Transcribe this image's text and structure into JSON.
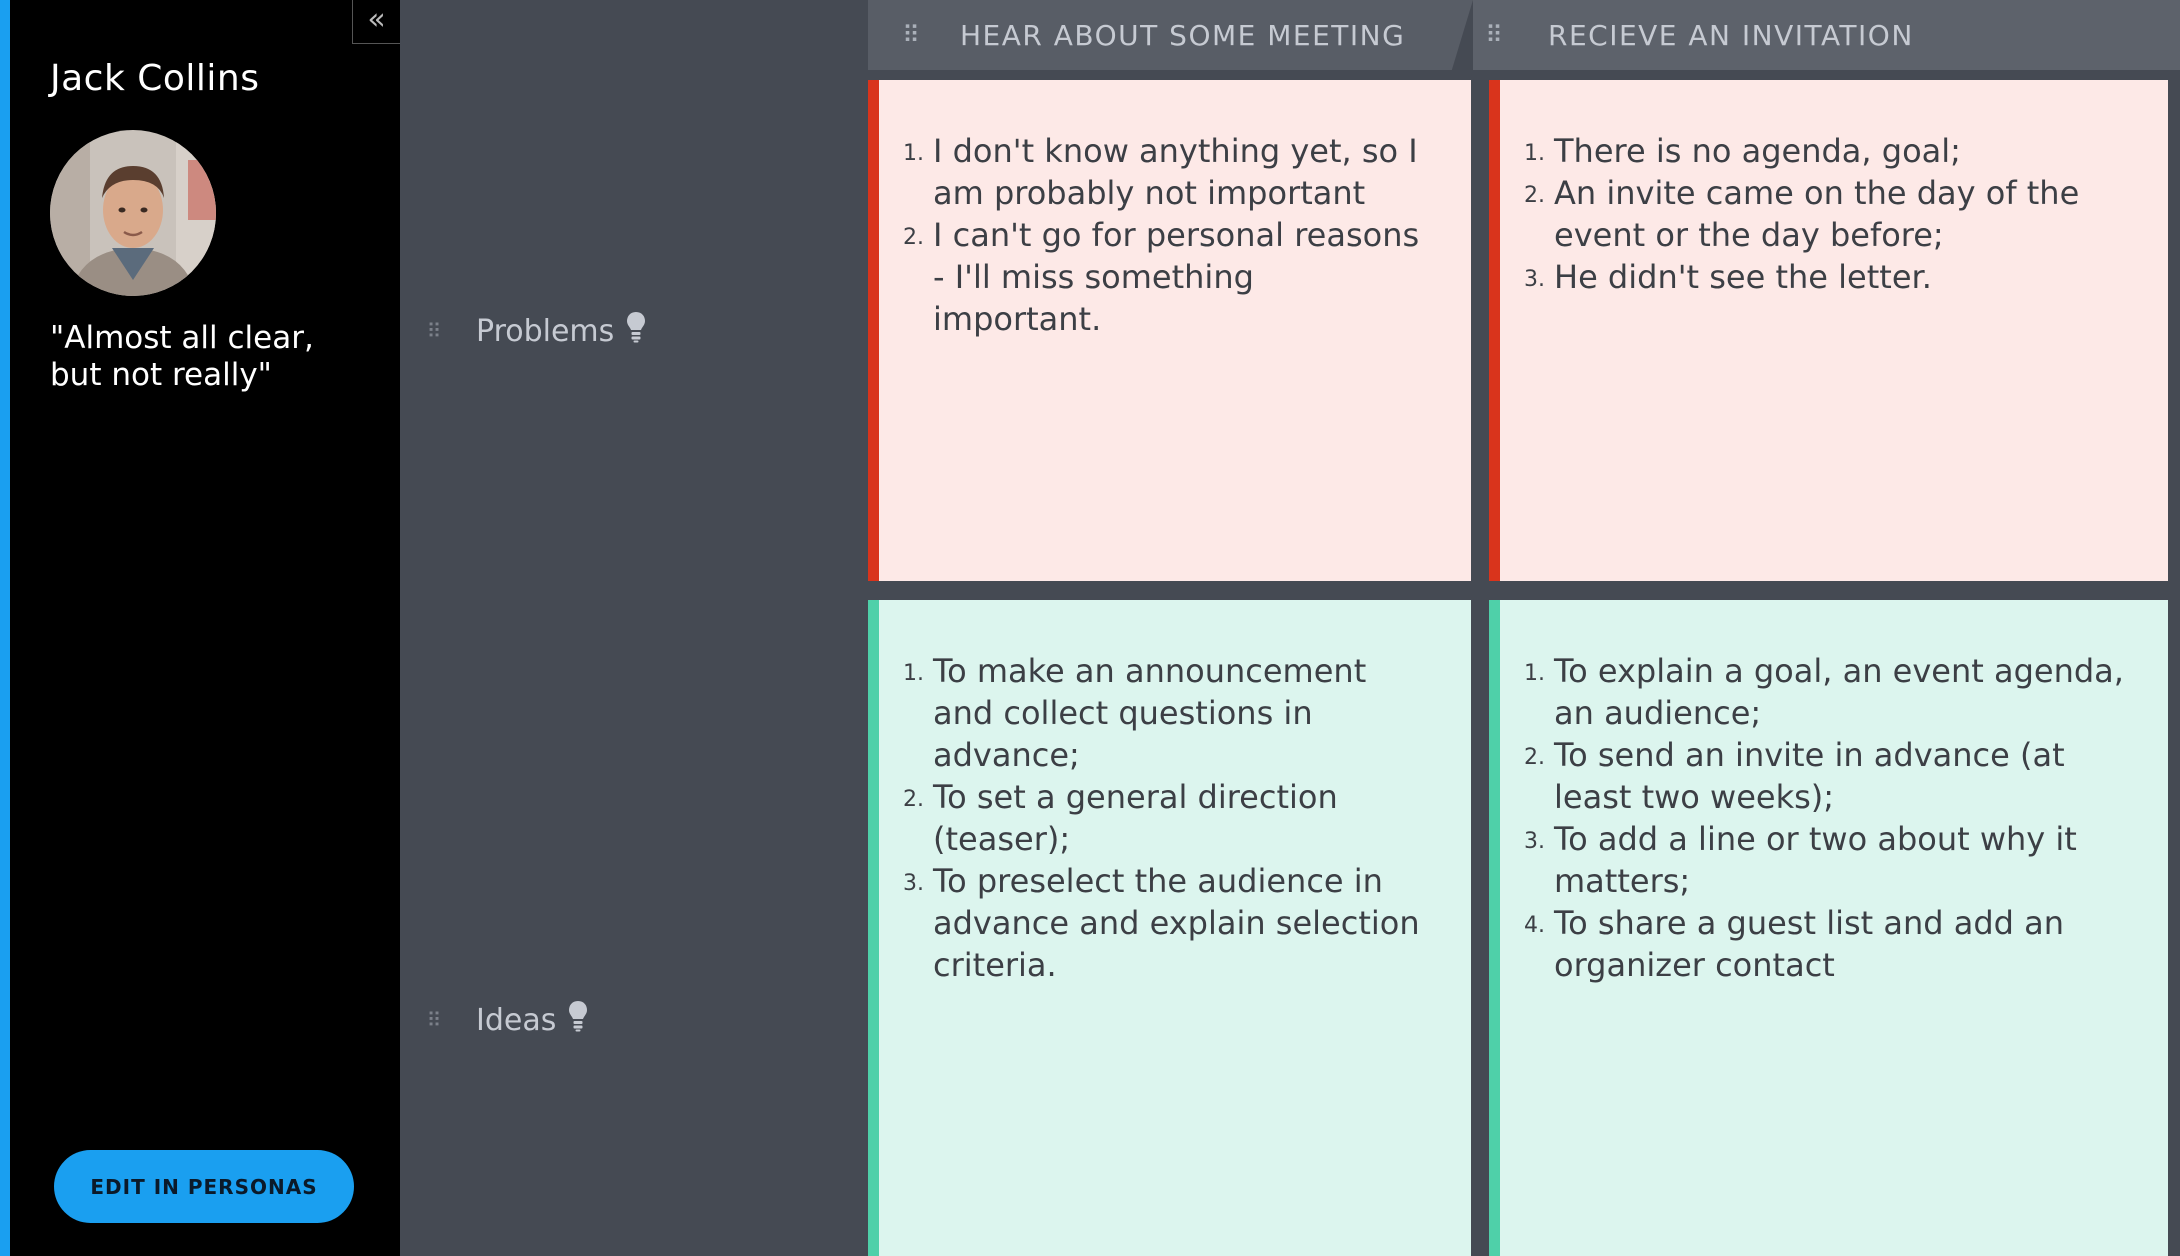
{
  "sidebar": {
    "collapse_label": "«",
    "name": "Jack Collins",
    "quote": "\"Almost all clear, but not really\"",
    "edit_button": "EDIT IN PERSONAS",
    "accent_color": "#1a9ff0"
  },
  "columns": [
    {
      "title": "HEAR ABOUT SOME MEETING",
      "handle_icon": "drag-handle-icon"
    },
    {
      "title": "RECIEVE AN INVITATION",
      "handle_icon": "drag-handle-icon"
    }
  ],
  "rows": [
    {
      "label": "Problems",
      "icon": "lightbulb-icon",
      "color": "#d9341c"
    },
    {
      "label": "Ideas",
      "icon": "lightbulb-icon",
      "color": "#4fd0a9"
    }
  ],
  "cards": {
    "problems": [
      {
        "items": [
          "I don't know anything yet, so I am probably not important",
          "I can't go for personal reasons - I'll miss something important."
        ]
      },
      {
        "items": [
          "There is no agenda, goal;",
          "An invite came on the day of the event or the day before;",
          "He didn't see the letter."
        ]
      }
    ],
    "ideas": [
      {
        "items": [
          "To make an announcement and collect questions in advance;",
          "To set a general direction (teaser);",
          "To preselect the audience in advance and explain selection criteria."
        ]
      },
      {
        "items": [
          "To explain a goal, an event agenda, an audience;",
          "To send an invite in advance (at least two weeks);",
          "To add a line or two about why it matters;",
          "To share a guest list and add an organizer contact"
        ]
      }
    ]
  },
  "numbers": [
    "1.",
    "2.",
    "3.",
    "4."
  ]
}
